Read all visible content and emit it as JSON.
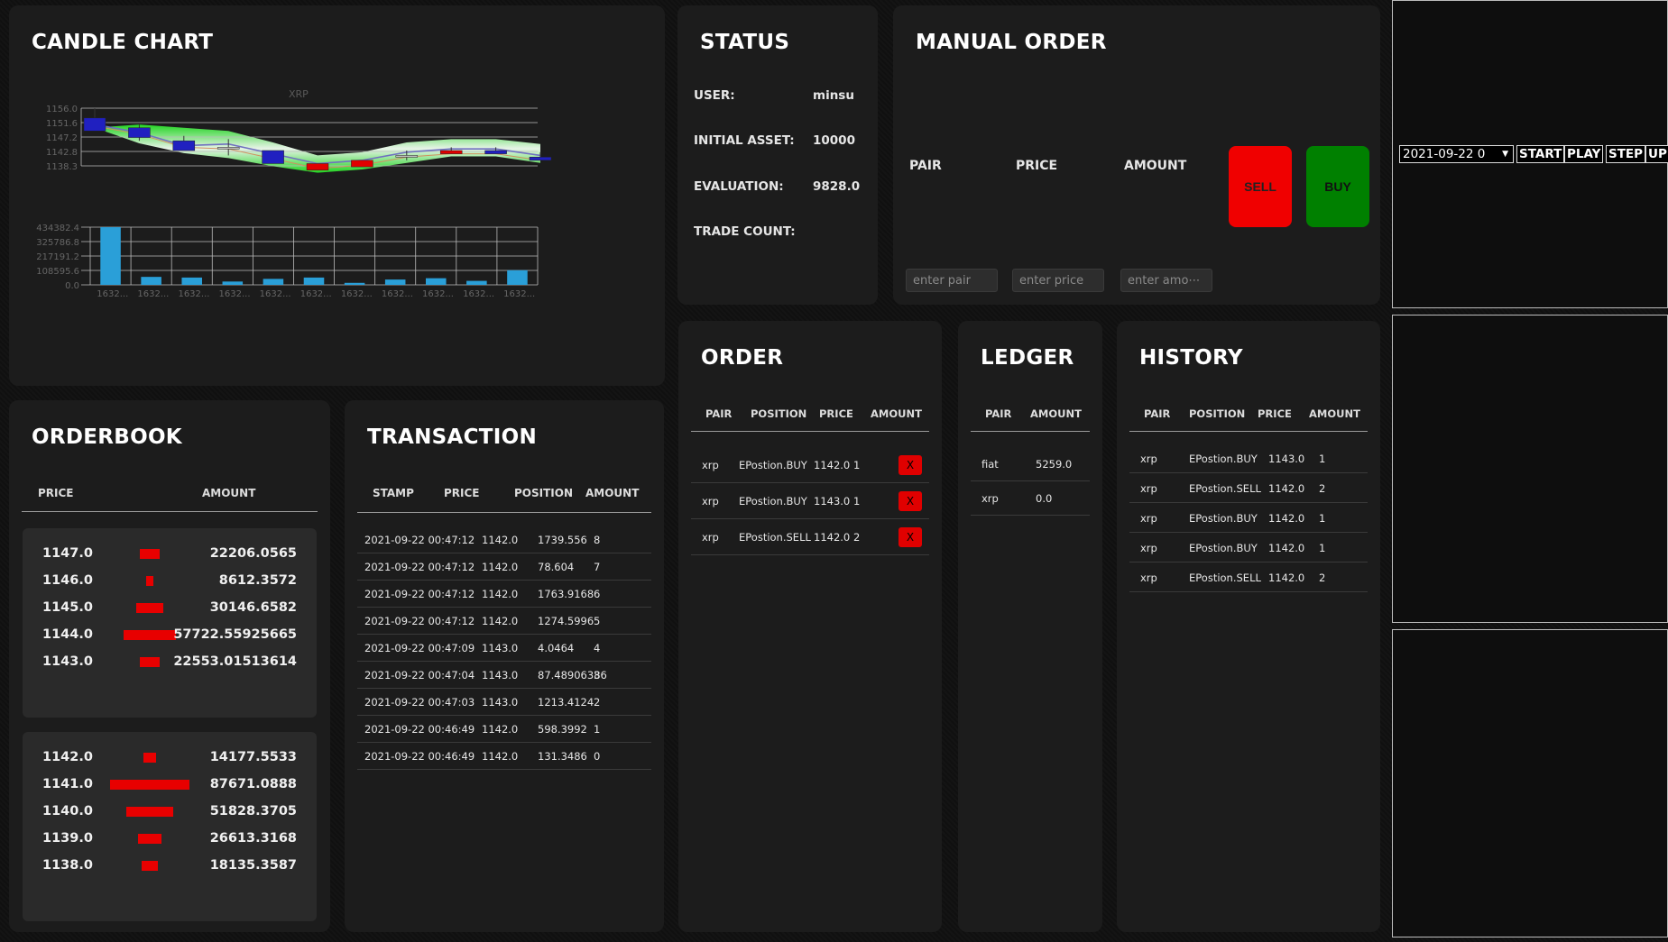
{
  "candle": {
    "title": "CANDLE CHART",
    "chart_title": "XRP",
    "price_ticks": [
      "1156.0",
      "1151.6",
      "1147.2",
      "1142.8",
      "1138.3"
    ],
    "volume_ticks": [
      "434382.4",
      "325786.8",
      "217191.2",
      "108595.6",
      "0.0"
    ],
    "x_tick_label": "1632...",
    "candles": [
      {
        "o": 1149,
        "c": 1153,
        "h": 1156,
        "l": 1149,
        "color": "#2020c0"
      },
      {
        "o": 1147,
        "c": 1150,
        "h": 1151,
        "l": 1146,
        "color": "#2020c0"
      },
      {
        "o": 1143,
        "c": 1146,
        "h": 1147.5,
        "l": 1143,
        "color": "#2020c0"
      },
      {
        "o": 1144,
        "c": 1144,
        "h": 1146.5,
        "l": 1141.5,
        "color": "#c0c0c0"
      },
      {
        "o": 1139,
        "c": 1143,
        "h": 1143,
        "l": 1139,
        "color": "#2020c0"
      },
      {
        "o": 1139,
        "c": 1137,
        "h": 1139,
        "l": 1137,
        "color": "#e00000"
      },
      {
        "o": 1140,
        "c": 1138,
        "h": 1140,
        "l": 1138,
        "color": "#e00000"
      },
      {
        "o": 1141.5,
        "c": 1141.5,
        "h": 1143,
        "l": 1140,
        "color": "#c0c0c0"
      },
      {
        "o": 1143,
        "c": 1142,
        "h": 1144,
        "l": 1142,
        "color": "#e00000"
      },
      {
        "o": 1142,
        "c": 1143,
        "h": 1144,
        "l": 1142,
        "color": "#2020c0"
      },
      {
        "o": 1140,
        "c": 1141,
        "h": 1142.5,
        "l": 1140,
        "color": "#2020c0"
      }
    ],
    "volumes": [
      434382,
      60000,
      55000,
      25000,
      45000,
      55000,
      15000,
      40000,
      50000,
      30000,
      110000
    ]
  },
  "status": {
    "title": "STATUS",
    "user_label": "USER:",
    "user_value": "minsu",
    "asset_label": "INITIAL ASSET:",
    "asset_value": "10000",
    "eval_label": "EVALUATION:",
    "eval_value": "9828.0",
    "count_label": "TRADE COUNT:",
    "count_value": ""
  },
  "manual": {
    "title": "MANUAL ORDER",
    "pair_label": "PAIR",
    "price_label": "PRICE",
    "amount_label": "AMOUNT",
    "sell_label": "SELL",
    "buy_label": "BUY",
    "pair_placeholder": "enter pair",
    "price_placeholder": "enter price",
    "amount_placeholder": "enter amo⋯"
  },
  "controls": {
    "date_value": "2021-09-22 0",
    "start": "START",
    "play": "PLAY",
    "step": "STEP",
    "up": "UP"
  },
  "orderbook": {
    "title": "ORDERBOOK",
    "col_price": "PRICE",
    "col_amount": "AMOUNT",
    "asks": [
      {
        "price": "1147.0",
        "amount": "22206.0565",
        "bar": 22206.0565
      },
      {
        "price": "1146.0",
        "amount": "8612.3572",
        "bar": 8612.3572
      },
      {
        "price": "1145.0",
        "amount": "30146.6582",
        "bar": 30146.6582
      },
      {
        "price": "1144.0",
        "amount": "57722.55925665",
        "bar": 57722.55925665
      },
      {
        "price": "1143.0",
        "amount": "22553.01513614",
        "bar": 22553.01513614
      }
    ],
    "bids": [
      {
        "price": "1142.0",
        "amount": "14177.5533",
        "bar": 14177.5533
      },
      {
        "price": "1141.0",
        "amount": "87671.0888",
        "bar": 87671.0888
      },
      {
        "price": "1140.0",
        "amount": "51828.3705",
        "bar": 51828.3705
      },
      {
        "price": "1139.0",
        "amount": "26613.3168",
        "bar": 26613.3168
      },
      {
        "price": "1138.0",
        "amount": "18135.3587",
        "bar": 18135.3587
      }
    ]
  },
  "transaction": {
    "title": "TRANSACTION",
    "cols": [
      "STAMP",
      "PRICE",
      "POSITION",
      "AMOUNT"
    ],
    "rows": [
      [
        "2021-09-22 00:47:12",
        "1142.0",
        "1739.556",
        "8"
      ],
      [
        "2021-09-22 00:47:12",
        "1142.0",
        "78.604",
        "7"
      ],
      [
        "2021-09-22 00:47:12",
        "1142.0",
        "1763.9168",
        "6"
      ],
      [
        "2021-09-22 00:47:12",
        "1142.0",
        "1274.5996",
        "5"
      ],
      [
        "2021-09-22 00:47:09",
        "1143.0",
        "4.0464",
        "4"
      ],
      [
        "2021-09-22 00:47:04",
        "1143.0",
        "87.48906386",
        "3"
      ],
      [
        "2021-09-22 00:47:03",
        "1143.0",
        "1213.4124",
        "2"
      ],
      [
        "2021-09-22 00:46:49",
        "1142.0",
        "598.3992",
        "1"
      ],
      [
        "2021-09-22 00:46:49",
        "1142.0",
        "131.3486",
        "0"
      ]
    ]
  },
  "order": {
    "title": "ORDER",
    "cols": [
      "PAIR",
      "POSITION",
      "PRICE",
      "AMOUNT"
    ],
    "cancel_label": "X",
    "rows": [
      [
        "xrp",
        "EPostion.BUY",
        "1142.0",
        "1"
      ],
      [
        "xrp",
        "EPostion.BUY",
        "1143.0",
        "1"
      ],
      [
        "xrp",
        "EPostion.SELL",
        "1142.0",
        "2"
      ]
    ]
  },
  "ledger": {
    "title": "LEDGER",
    "cols": [
      "PAIR",
      "AMOUNT"
    ],
    "rows": [
      [
        "fiat",
        "5259.0"
      ],
      [
        "xrp",
        "0.0"
      ]
    ]
  },
  "history": {
    "title": "HISTORY",
    "cols": [
      "PAIR",
      "POSITION",
      "PRICE",
      "AMOUNT"
    ],
    "rows": [
      [
        "xrp",
        "EPostion.BUY",
        "1143.0",
        "1"
      ],
      [
        "xrp",
        "EPostion.SELL",
        "1142.0",
        "2"
      ],
      [
        "xrp",
        "EPostion.BUY",
        "1142.0",
        "1"
      ],
      [
        "xrp",
        "EPostion.BUY",
        "1142.0",
        "1"
      ],
      [
        "xrp",
        "EPostion.SELL",
        "1142.0",
        "2"
      ]
    ]
  }
}
